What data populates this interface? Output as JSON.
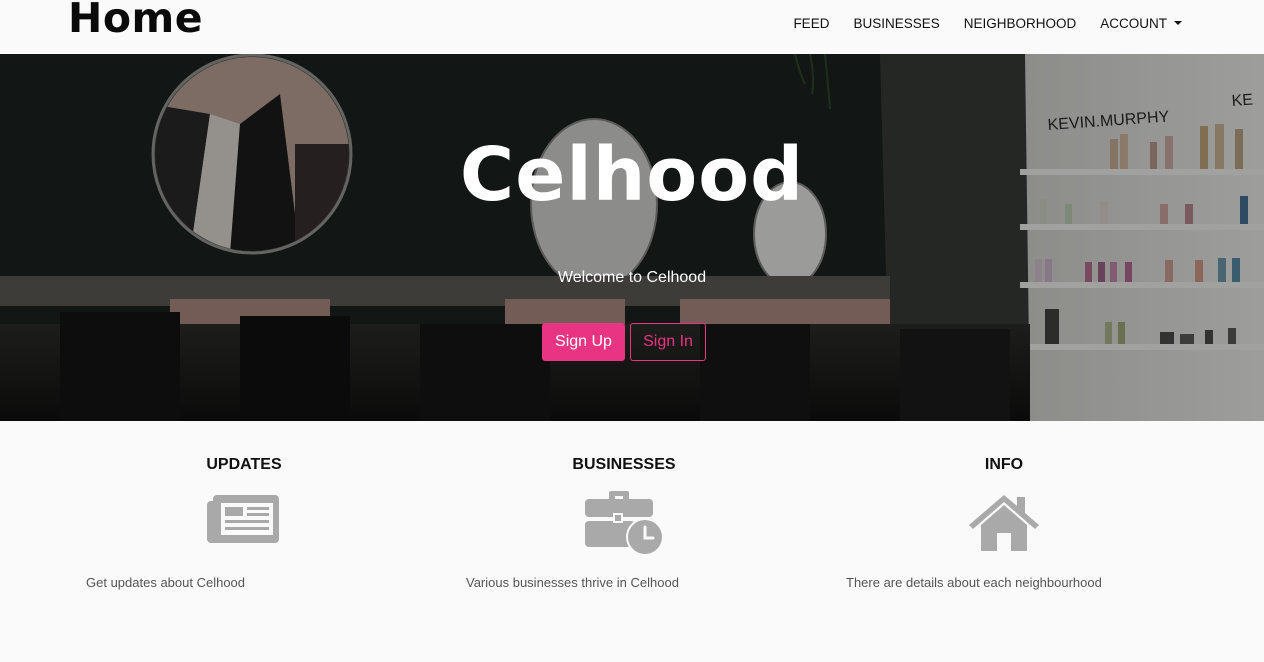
{
  "navbar": {
    "brand": "Home",
    "links": [
      {
        "label": "FEED"
      },
      {
        "label": "BUSINESSES"
      },
      {
        "label": "NEIGHBORHOOD"
      },
      {
        "label": "ACCOUNT"
      }
    ]
  },
  "hero": {
    "title": "Celhood",
    "subtitle": "Welcome to Celhood",
    "signup_label": "Sign Up",
    "signin_label": "Sign In",
    "shelf_sign_text": "KEVIN.MURPHY",
    "shelf_sign_text_2": "KE"
  },
  "features": [
    {
      "title": "UPDATES",
      "icon": "newspaper-icon",
      "text": "Get updates about Celhood"
    },
    {
      "title": "BUSINESSES",
      "icon": "briefcase-clock-icon",
      "text": "Various businesses thrive in Celhood"
    },
    {
      "title": "INFO",
      "icon": "home-icon",
      "text": "There are details about each neighbourhood"
    }
  ],
  "colors": {
    "accent": "#e93383",
    "icon_gray": "#a9a9a9",
    "hero_overlay": "#1c2220"
  }
}
